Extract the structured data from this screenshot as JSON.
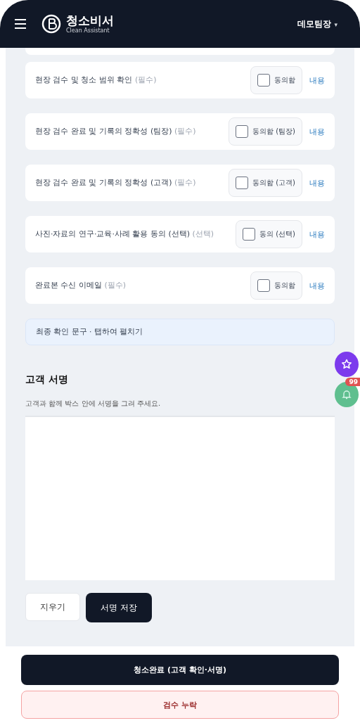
{
  "header": {
    "brand": "청소비서",
    "brand_sub": "Clean Assistant",
    "user": "데모팀장",
    "user_caret": "▾"
  },
  "consents": [
    {
      "label": "현장 검수 및 청소 범위 확인",
      "tag": "(필수)",
      "agree": "동의함",
      "checked": false,
      "link": "내용"
    },
    {
      "label": "현장 검수 완료 및 기록의 정확성 (팀장)",
      "tag": "(필수)",
      "agree": "동의함 (팀장)",
      "checked": false,
      "link": "내용"
    },
    {
      "label": "현장 검수 완료 및 기록의 정확성 (고객)",
      "tag": "(필수)",
      "agree": "동의함 (고객)",
      "checked": false,
      "link": "내용"
    },
    {
      "label": "사진·자료의 연구·교육·사례 활용 동의 (선택)",
      "tag": "(선택)",
      "agree": "동의 (선택)",
      "checked": false,
      "link": "내용"
    },
    {
      "label": "완료본 수신 이메일",
      "tag": "(필수)",
      "agree": "동의함",
      "checked": false,
      "link": "내용"
    }
  ],
  "notice": "최종 확인 문구 · 탭하여 펼치기",
  "signature": {
    "title": "고객 서명",
    "hint": "고객과 함께 박스 안에 서명을 그려 주세요.",
    "clear": "지우기",
    "save": "서명 저장"
  },
  "floating": {
    "badge": "99"
  },
  "actions": {
    "complete": "청소완료 (고객 확인·서명)",
    "missing": "검수 누락"
  }
}
